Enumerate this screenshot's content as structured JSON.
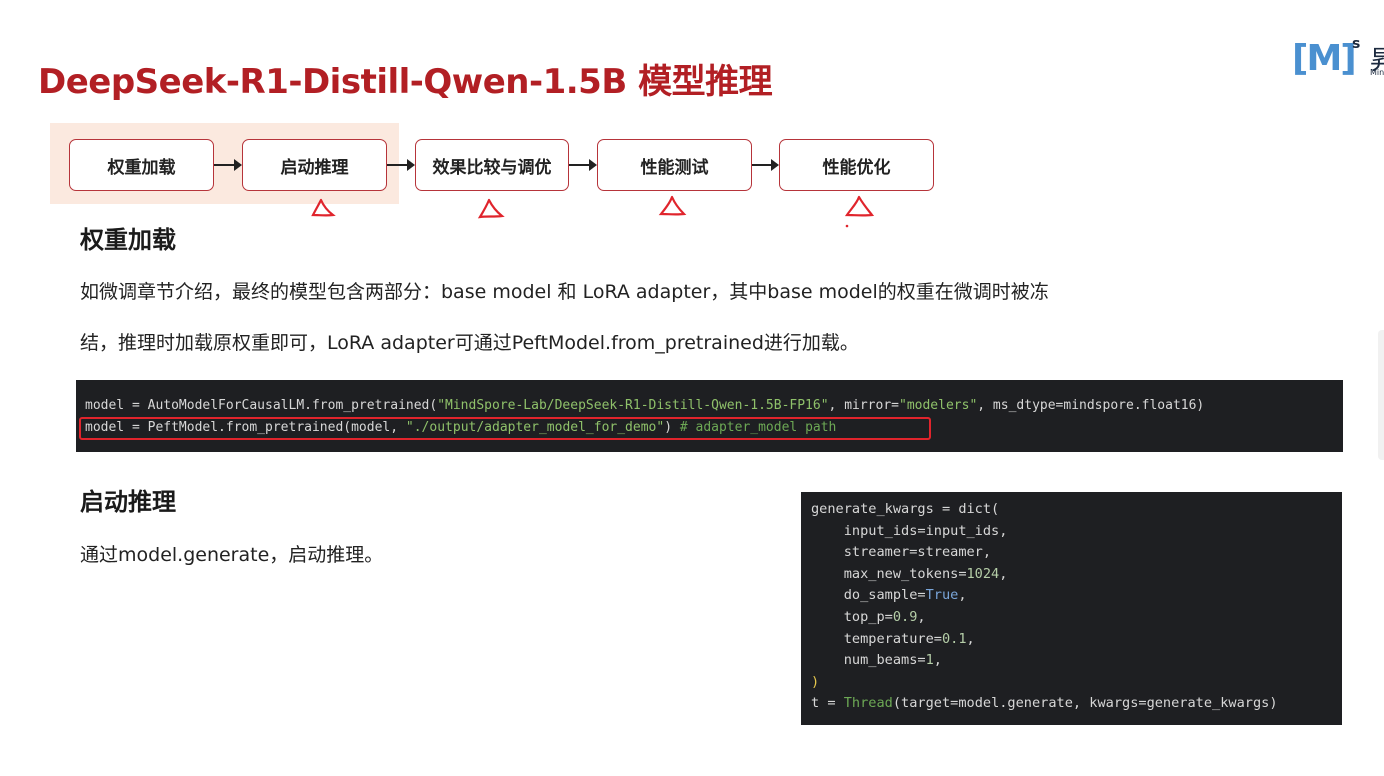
{
  "title": "DeepSeek-R1-Distill-Qwen-1.5B 模型推理",
  "logo": {
    "mark": "[M]",
    "sup": "s",
    "cn": "昇",
    "en": "Min"
  },
  "steps": [
    "权重加载",
    "启动推理",
    "效果比较与调优",
    "性能测试",
    "性能优化"
  ],
  "section1": {
    "heading": "权重加载",
    "para_line1": "如微调章节介绍，最终的模型包含两部分：base model 和 LoRA adapter，其中base model的权重在微调时被冻",
    "para_line2": "结，推理时加载原权重即可，LoRA adapter可通过PeftModel.from_pretrained进行加载。"
  },
  "code1": {
    "line1": {
      "a": "model = AutoModelForCausalLM.from_pretrained(",
      "b": "\"MindSpore-Lab/DeepSeek-R1-Distill-Qwen-1.5B-FP16\"",
      "c": ", mirror=",
      "d": "\"modelers\"",
      "e": ", ms_dtype=mindspore.float16)"
    },
    "line2": {
      "a": "model = PeftModel.from_pretrained(model, ",
      "b": "\"./output/adapter_model_for_demo\"",
      "c": ") ",
      "d": "# adapter_model path"
    }
  },
  "section2": {
    "heading": "启动推理",
    "para": "通过model.generate，启动推理。"
  },
  "code2": {
    "l1": "generate_kwargs = dict(",
    "l2": "    input_ids=input_ids,",
    "l3": "    streamer=streamer,",
    "l4a": "    max_new_tokens=",
    "l4b": "1024",
    "l4c": ",",
    "l5a": "    do_sample=",
    "l5b": "True",
    "l5c": ",",
    "l6a": "    top_p=",
    "l6b": "0.9",
    "l6c": ",",
    "l7a": "    temperature=",
    "l7b": "0.1",
    "l7c": ",",
    "l8a": "    num_beams=",
    "l8b": "1",
    "l8c": ",",
    "l9": ")",
    "l10a": "t = ",
    "l10b": "Thread",
    "l10c": "(target=model.generate, kwargs=generate_kwargs)"
  },
  "colors": {
    "title": "#b21f24",
    "step_border": "#b6343a",
    "highlight": "#fbe9df",
    "annotation": "#e0242c",
    "code_bg": "#1e1f22"
  }
}
